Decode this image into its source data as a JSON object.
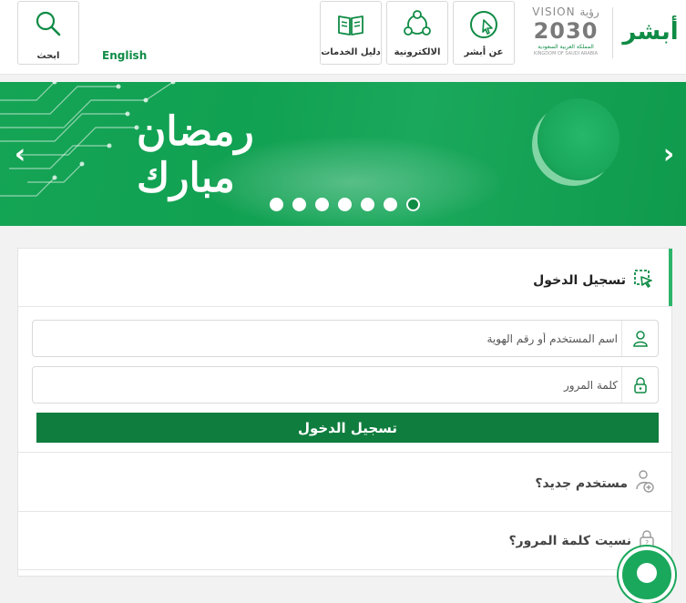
{
  "header": {
    "logo_text": "أبشر",
    "vision": {
      "arabic": "رؤية",
      "top": "VISION",
      "year": "2030",
      "sub_ar": "المملكة العربية السعودية",
      "sub_en": "KINGDOM OF SAUDI ARABIA"
    },
    "nav": {
      "about_label": "عن أبشر",
      "eservices_label": "الالكترونية",
      "guide_label": "دليل الخدمات"
    },
    "language_label": "English",
    "search_label": "ابحث"
  },
  "banner": {
    "title": "رمضان مبارك",
    "slide_count": 7,
    "active_slide": 7,
    "prev_label": "‹",
    "next_label": "›"
  },
  "login": {
    "title": "تسجيل الدخول",
    "username_placeholder": "اسم المستخدم أو رقم الهوية",
    "password_placeholder": "كلمة المرور",
    "submit_label": "تسجيل الدخول"
  },
  "links": {
    "new_user": "مستخدم جديد؟",
    "forgot_password": "نسيت كلمة المرور؟"
  },
  "colors": {
    "brand_green": "#0f8b45",
    "button_green": "#0f7d3e",
    "banner_green": "#15a455"
  }
}
